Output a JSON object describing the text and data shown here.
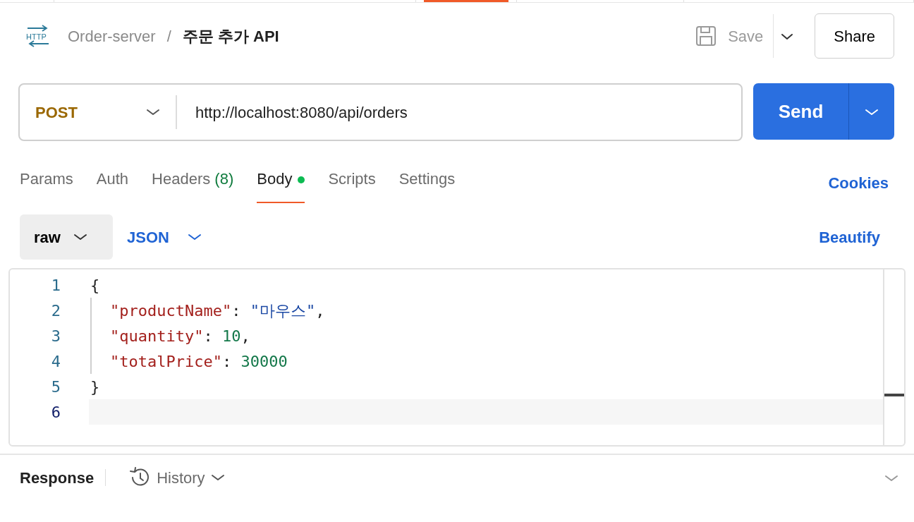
{
  "tab_strip": [
    {
      "selected": false
    },
    {
      "selected": false
    },
    {
      "selected": true
    },
    {
      "selected": false
    },
    {
      "selected": false
    }
  ],
  "header": {
    "logo_text": "HTTP",
    "breadcrumb": [
      {
        "text": "Order-server",
        "current": false
      },
      {
        "text": "주문 추가 API",
        "current": true
      }
    ],
    "separator": "/",
    "save_label": "Save",
    "share_label": "Share"
  },
  "request": {
    "method": "POST",
    "url": "http://localhost:8080/api/orders",
    "send_label": "Send"
  },
  "tabs": [
    {
      "label": "Params",
      "selected": false,
      "dot": false
    },
    {
      "label": "Auth",
      "selected": false,
      "dot": false
    },
    {
      "label": "Headers",
      "count": "(8)",
      "selected": false,
      "dot": false
    },
    {
      "label": "Body",
      "selected": true,
      "dot": true
    },
    {
      "label": "Scripts",
      "selected": false,
      "dot": false
    },
    {
      "label": "Settings",
      "selected": false,
      "dot": false
    }
  ],
  "cookies_label": "Cookies",
  "body_options": {
    "mode": "raw",
    "language": "JSON",
    "beautify_label": "Beautify"
  },
  "editor": {
    "lines": [
      {
        "number": "1",
        "indented": false,
        "active": false,
        "tokens": [
          {
            "kind": "punct",
            "text": "{"
          }
        ]
      },
      {
        "number": "2",
        "indented": true,
        "active": false,
        "tokens": [
          {
            "kind": "key",
            "text": "\"productName\""
          },
          {
            "kind": "punct",
            "text": ": "
          },
          {
            "kind": "string",
            "text": "\"마우스\""
          },
          {
            "kind": "punct",
            "text": ","
          }
        ]
      },
      {
        "number": "3",
        "indented": true,
        "active": false,
        "tokens": [
          {
            "kind": "key",
            "text": "\"quantity\""
          },
          {
            "kind": "punct",
            "text": ": "
          },
          {
            "kind": "number",
            "text": "10"
          },
          {
            "kind": "punct",
            "text": ","
          }
        ]
      },
      {
        "number": "4",
        "indented": true,
        "active": false,
        "tokens": [
          {
            "kind": "key",
            "text": "\"totalPrice\""
          },
          {
            "kind": "punct",
            "text": ": "
          },
          {
            "kind": "number",
            "text": "30000"
          }
        ]
      },
      {
        "number": "5",
        "indented": false,
        "active": false,
        "tokens": [
          {
            "kind": "punct",
            "text": "}"
          }
        ]
      },
      {
        "number": "6",
        "indented": false,
        "active": true
      }
    ]
  },
  "response": {
    "title": "Response",
    "history_label": "History"
  }
}
